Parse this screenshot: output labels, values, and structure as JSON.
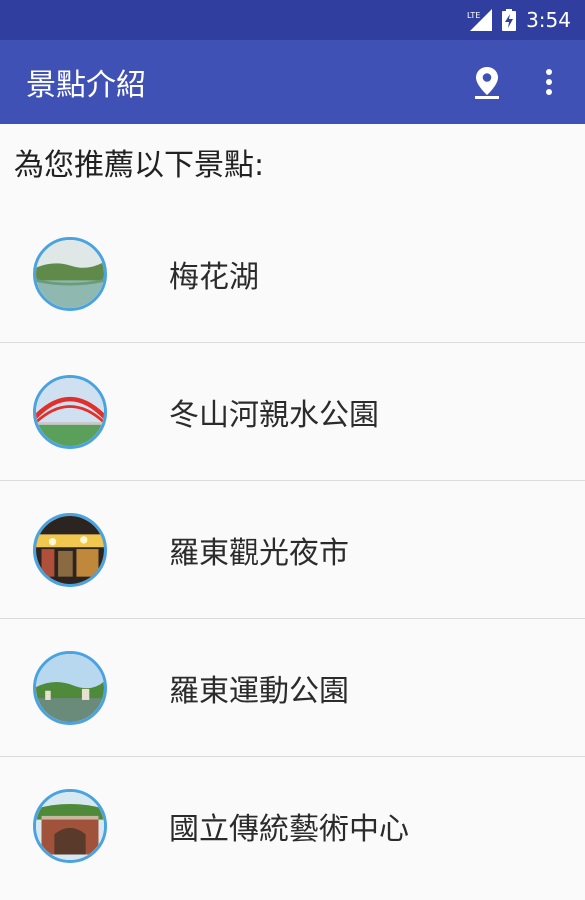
{
  "status_bar": {
    "network": "LTE",
    "time": "3:54"
  },
  "app_bar": {
    "title": "景點介紹",
    "actions": [
      "map-pin-icon",
      "more-vert-icon"
    ]
  },
  "heading": "為您推薦以下景點:",
  "attractions": [
    {
      "name": "梅花湖"
    },
    {
      "name": "冬山河親水公園"
    },
    {
      "name": "羅東觀光夜市"
    },
    {
      "name": "羅東運動公園"
    },
    {
      "name": "國立傳統藝術中心"
    }
  ],
  "colors": {
    "status_bar": "#303f9f",
    "app_bar": "#3f51b5",
    "thumb_border": "#4aa3df",
    "background": "#fafafa"
  }
}
